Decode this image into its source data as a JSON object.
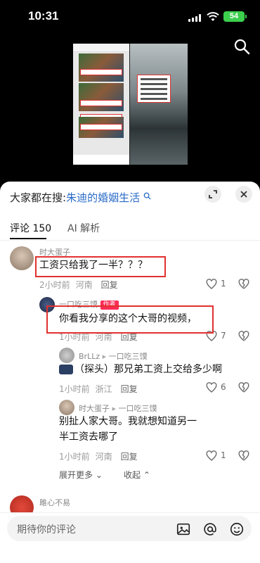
{
  "status_bar": {
    "time": "10:31",
    "battery": "54"
  },
  "sheet": {
    "hot_search": {
      "prefix": "大家都在搜:",
      "keyword": "朱迪的婚姻生活"
    },
    "tabs": [
      {
        "label": "评论 150"
      },
      {
        "label": "AI 解析"
      }
    ],
    "comments": [
      {
        "user": "时大蛋子",
        "text": "工资只给我了一半？？？",
        "time": "2小时前",
        "location": "河南",
        "reply": "回复",
        "likes": "1"
      },
      {
        "user": "一口吃三馍",
        "badge": "作者",
        "text": "你看我分享的这个大哥的视频，",
        "time": "1小时前",
        "location": "河南",
        "reply": "回复",
        "likes": "7"
      },
      {
        "user": "BrLLz",
        "reply_to": "一口吃三馍",
        "emoji_text": "（探头）",
        "text": "那兄弟工资上交给多少啊",
        "time": "1小时前",
        "location": "浙江",
        "reply": "回复",
        "likes": "6"
      },
      {
        "user": "时大蛋子",
        "reply_to": "一口吃三馍",
        "text": "别扯人家大哥。我就想知道另一半工资去哪了",
        "time": "1小时前",
        "location": "河南",
        "reply": "回复",
        "likes": "1"
      }
    ],
    "expand_label": "展开更多",
    "collapse_label": "收起",
    "next_user": "雎心不易",
    "input_placeholder": "期待你的评论"
  },
  "icons": {
    "search": "search-icon",
    "expand": "expand-icon",
    "close": "close-icon",
    "like": "heart-icon",
    "dislike": "broken-heart-icon",
    "image": "image-icon",
    "mention": "at-icon",
    "emoji": "emoji-icon"
  },
  "colors": {
    "highlight": "#e0312f",
    "keyword": "#2a6bc7",
    "author_badge": "#fe2c55",
    "battery": "#3ccf4e"
  }
}
